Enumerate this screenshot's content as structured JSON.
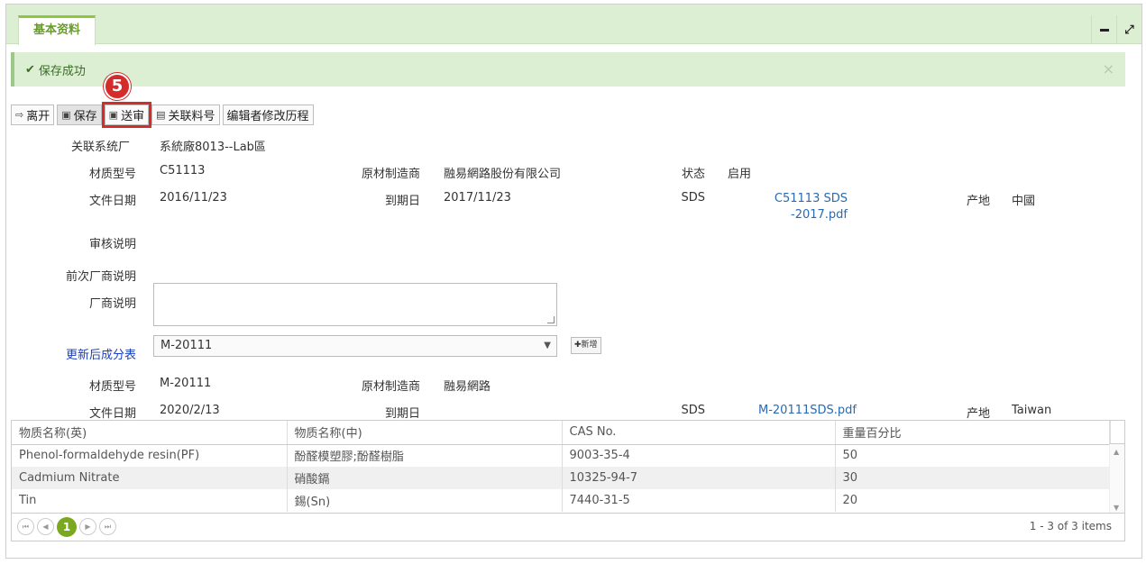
{
  "tab": {
    "label": "基本资料"
  },
  "alert": {
    "message": "保存成功"
  },
  "toolbar": {
    "leave": "离开",
    "save": "保存",
    "submit": "送审",
    "related": "关联料号",
    "history": "编辑者修改历程"
  },
  "badge": {
    "number": "5"
  },
  "form": {
    "related_factory_label": "关联系统厂",
    "related_factory_value": "系統廠8013--Lab區",
    "material_model_label": "材质型号",
    "material_model_value": "C51113",
    "manufacturer_label": "原材制造商",
    "manufacturer_value": "融易網路股份有限公司",
    "status_label": "状态",
    "status_value": "启用",
    "doc_date_label": "文件日期",
    "doc_date_value": "2016/11/23",
    "expiry_label": "到期日",
    "expiry_value": "2017/11/23",
    "sds_label": "SDS",
    "sds_file_line1": "C51113 SDS",
    "sds_file_line2": "-2017.pdf",
    "origin_label": "产地",
    "origin_value": "中國",
    "review_note_label": "审核说明",
    "prev_vendor_note_label": "前次厂商说明",
    "vendor_note_label": "厂商说明",
    "vendor_note_value": "",
    "updated_list_label": "更新后成分表",
    "updated_list_value": "M-20111",
    "add_label": "新增"
  },
  "form2": {
    "material_model_label": "材质型号",
    "material_model_value": "M-20111",
    "manufacturer_label": "原材制造商",
    "manufacturer_value": "融易網路",
    "doc_date_label": "文件日期",
    "doc_date_value": "2020/2/13",
    "expiry_label": "到期日",
    "expiry_value": "",
    "sds_label": "SDS",
    "sds_file": "M-20111SDS.pdf",
    "origin_label": "产地",
    "origin_value": "Taiwan"
  },
  "grid": {
    "headers": [
      "物质名称(英)",
      "物质名称(中)",
      "CAS No.",
      "重量百分比"
    ],
    "rows": [
      [
        "Phenol-formaldehyde resin(PF)",
        "酚醛模塑膠;酚醛樹脂",
        "9003-35-4",
        "50"
      ],
      [
        "Cadmium Nitrate",
        "硝酸鎘",
        "10325-94-7",
        "30"
      ],
      [
        "Tin",
        "錫(Sn)",
        "7440-31-5",
        "20"
      ]
    ]
  },
  "pager": {
    "current": "1",
    "info": "1 - 3 of 3 items"
  }
}
